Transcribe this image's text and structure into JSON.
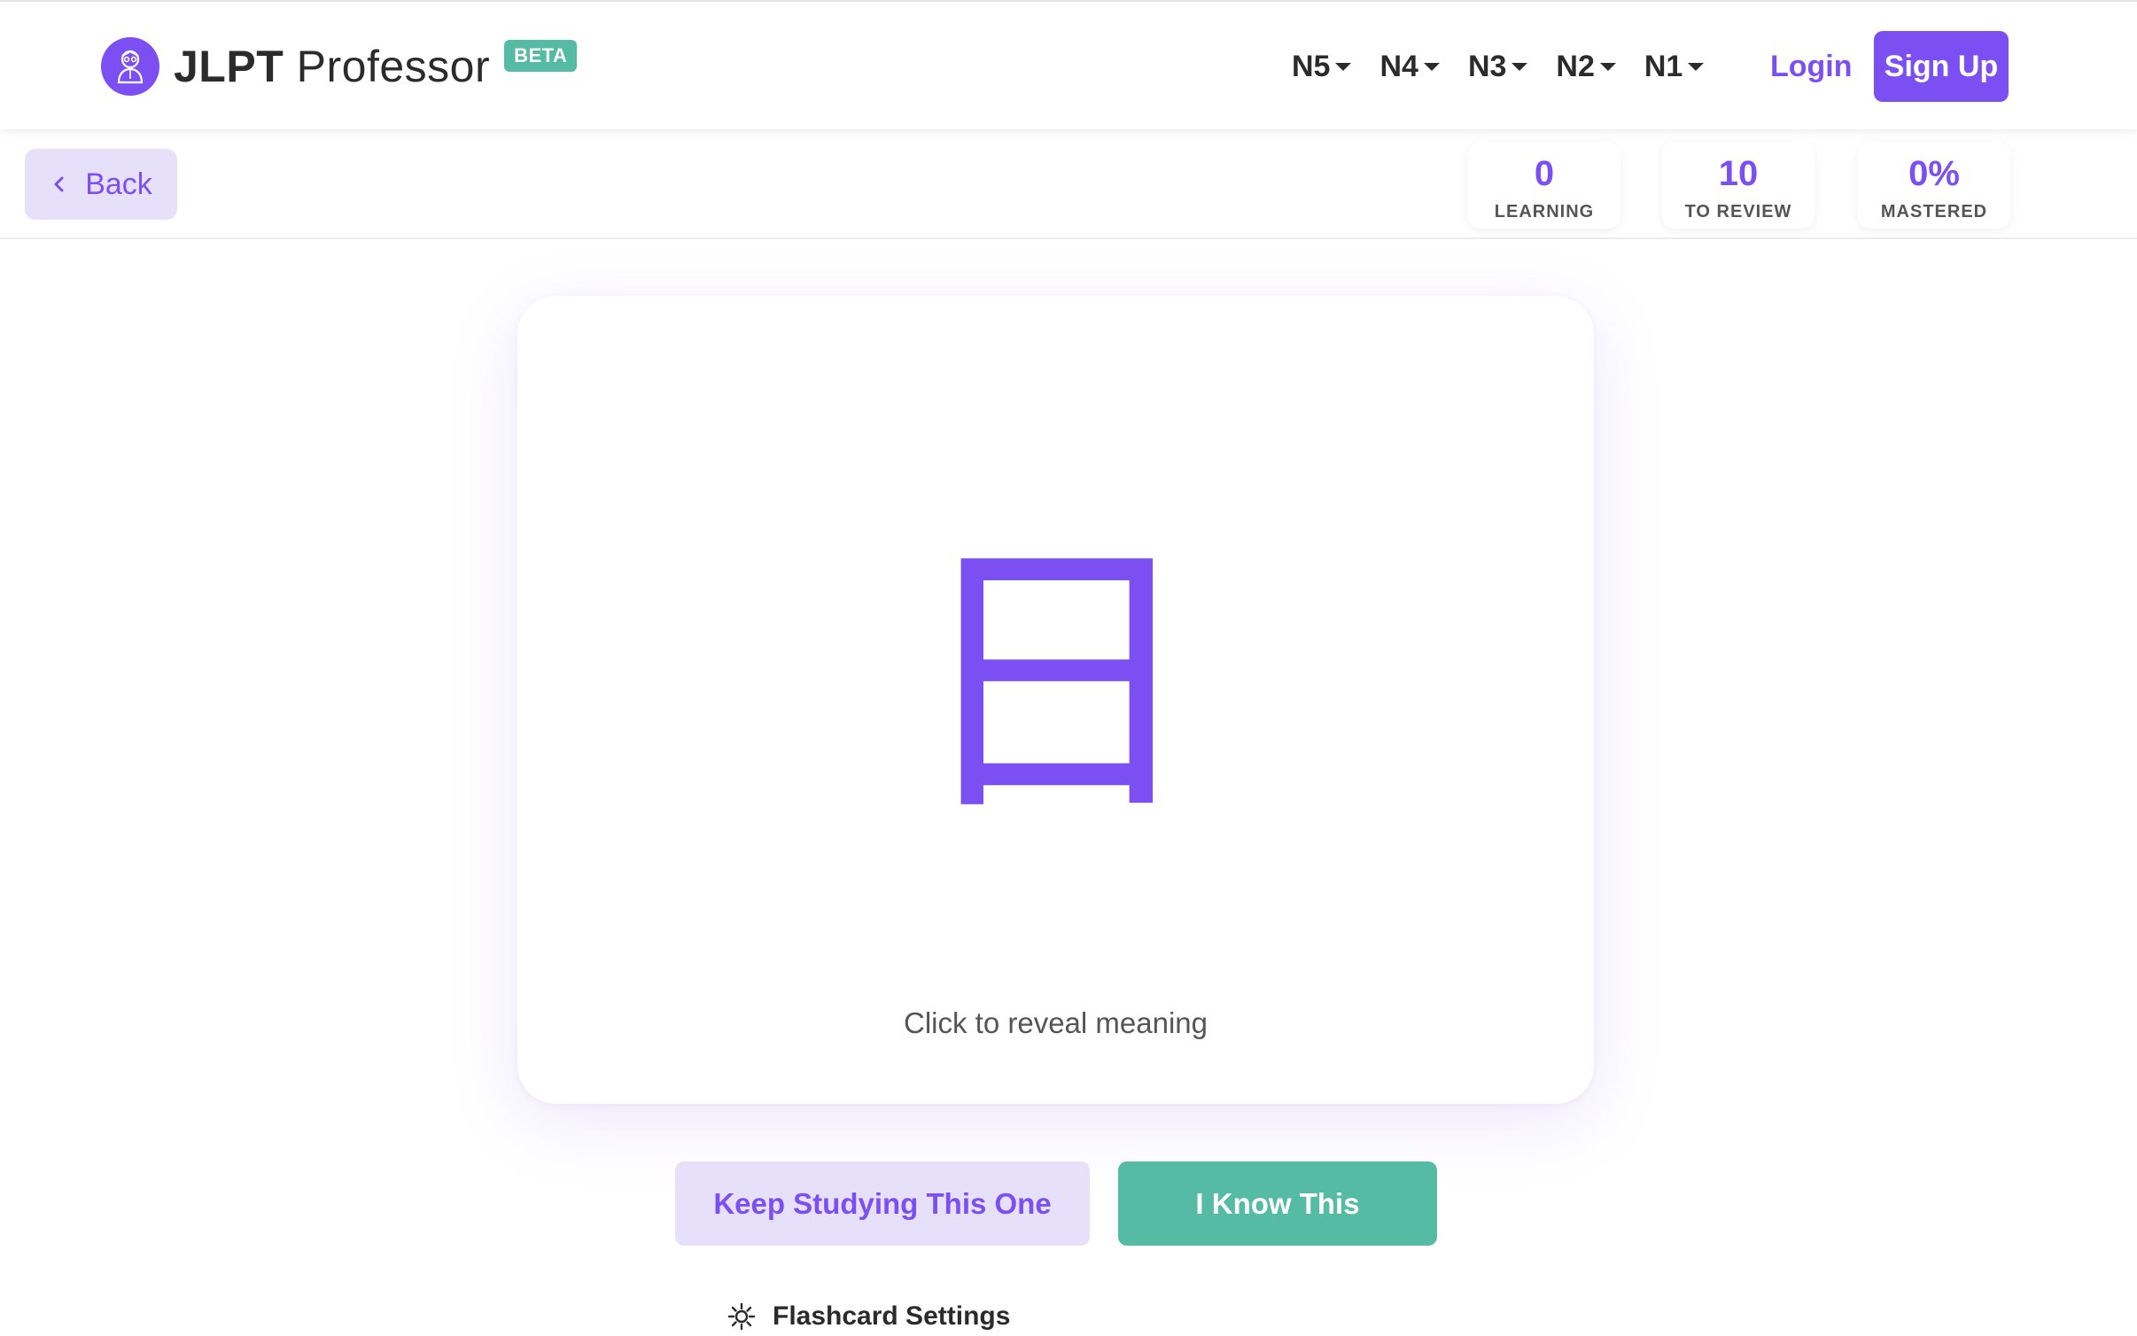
{
  "brand": {
    "name_bold": "JLPT",
    "name_light": "Professor",
    "badge": "BETA",
    "logo_icon": "professor-avatar-icon"
  },
  "nav": {
    "levels": [
      "N5",
      "N4",
      "N3",
      "N2",
      "N1"
    ],
    "login_label": "Login",
    "signup_label": "Sign Up"
  },
  "subheader": {
    "back_label": "Back",
    "stats": {
      "learning": {
        "value": "0",
        "label": "LEARNING"
      },
      "review": {
        "value": "10",
        "label": "TO REVIEW"
      },
      "mastered": {
        "value": "0%",
        "label": "MASTERED"
      }
    }
  },
  "flashcard": {
    "kanji": "日",
    "hint": "Click to reveal meaning"
  },
  "actions": {
    "keep_studying_label": "Keep Studying This One",
    "know_label": "I Know This"
  },
  "settings": {
    "label": "Flashcard Settings",
    "icon": "gear-icon"
  },
  "colors": {
    "accent": "#7b4ff2",
    "accent_light": "#e6e0fb",
    "success": "#55bba4",
    "text": "#2b2b2b"
  }
}
